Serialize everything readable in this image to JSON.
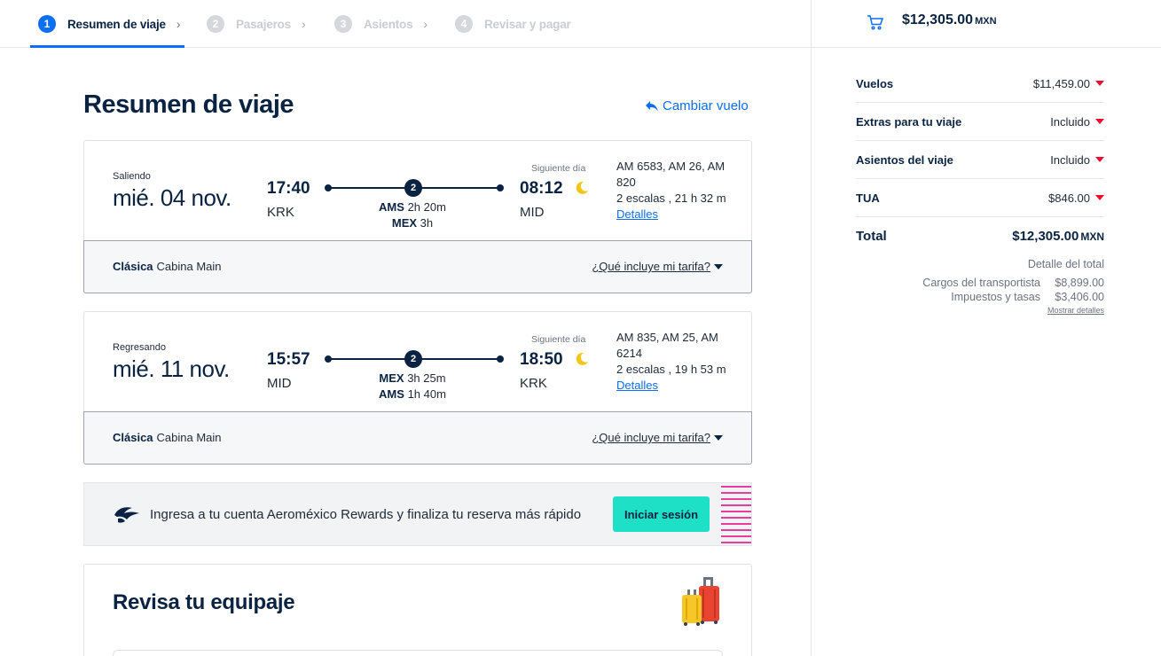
{
  "stepper": {
    "steps": [
      {
        "num": "1",
        "label": "Resumen de viaje",
        "active": true
      },
      {
        "num": "2",
        "label": "Pasajeros",
        "active": false
      },
      {
        "num": "3",
        "label": "Asientos",
        "active": false
      },
      {
        "num": "4",
        "label": "Revisar y pagar",
        "active": false
      }
    ]
  },
  "cart": {
    "amount": "$12,305.00",
    "currency": "MXN",
    "icon": "cart-icon"
  },
  "summary": {
    "rows": [
      {
        "label": "Vuelos",
        "value": "$11,459.00"
      },
      {
        "label": "Extras para tu viaje",
        "value": "Incluido"
      },
      {
        "label": "Asientos del viaje",
        "value": "Incluido"
      },
      {
        "label": "TUA",
        "value": "$846.00"
      }
    ],
    "total_label": "Total",
    "total_amount": "$12,305.00",
    "total_currency": "MXN",
    "detail_title": "Detalle del total",
    "details": [
      {
        "label": "Cargos del transportista",
        "value": "$8,899.00"
      },
      {
        "label": "Impuestos y tasas",
        "value": "$3,406.00"
      }
    ],
    "show_details": "Mostrar detalles"
  },
  "main": {
    "title": "Resumen de viaje",
    "change_flight": "Cambiar vuelo"
  },
  "flights": [
    {
      "direction": "Saliendo",
      "date": "mié. 04 nov.",
      "dep_time": "17:40",
      "dep_code": "KRK",
      "stops": "2",
      "layover1_code": "AMS",
      "layover1_dur": "2h 20m",
      "layover2_code": "MEX",
      "layover2_dur": "3h",
      "next_day": "Siguiente día",
      "arr_time": "08:12",
      "arr_code": "MID",
      "flight_numbers": "AM 6583, AM 26, AM 820",
      "summary": "2 escalas , 21 h 32 m",
      "details": "Detalles",
      "fare_class": "Clásica",
      "cabin": "Cabina Main",
      "fare_link": "¿Qué incluye mi tarifa?"
    },
    {
      "direction": "Regresando",
      "date": "mié. 11 nov.",
      "dep_time": "15:57",
      "dep_code": "MID",
      "stops": "2",
      "layover1_code": "MEX",
      "layover1_dur": "3h 25m",
      "layover2_code": "AMS",
      "layover2_dur": "1h 40m",
      "next_day": "Siguiente día",
      "arr_time": "18:50",
      "arr_code": "KRK",
      "flight_numbers": "AM 835, AM 25, AM 6214",
      "summary": "2 escalas , 19 h 53 m",
      "details": "Detalles",
      "fare_class": "Clásica",
      "cabin": "Cabina Main",
      "fare_link": "¿Qué incluye mi tarifa?"
    }
  ],
  "rewards": {
    "text": "Ingresa a tu cuenta Aeroméxico Rewards y finaliza tu reserva más rápido",
    "button": "Iniciar sesión"
  },
  "baggage": {
    "title": "Revisa tu equipaje"
  },
  "colors": {
    "primary": "#0c6ef3",
    "navy": "#0b2343",
    "accent_red": "#e8112d",
    "teal": "#1ee0c6",
    "moon": "#f5c518"
  }
}
